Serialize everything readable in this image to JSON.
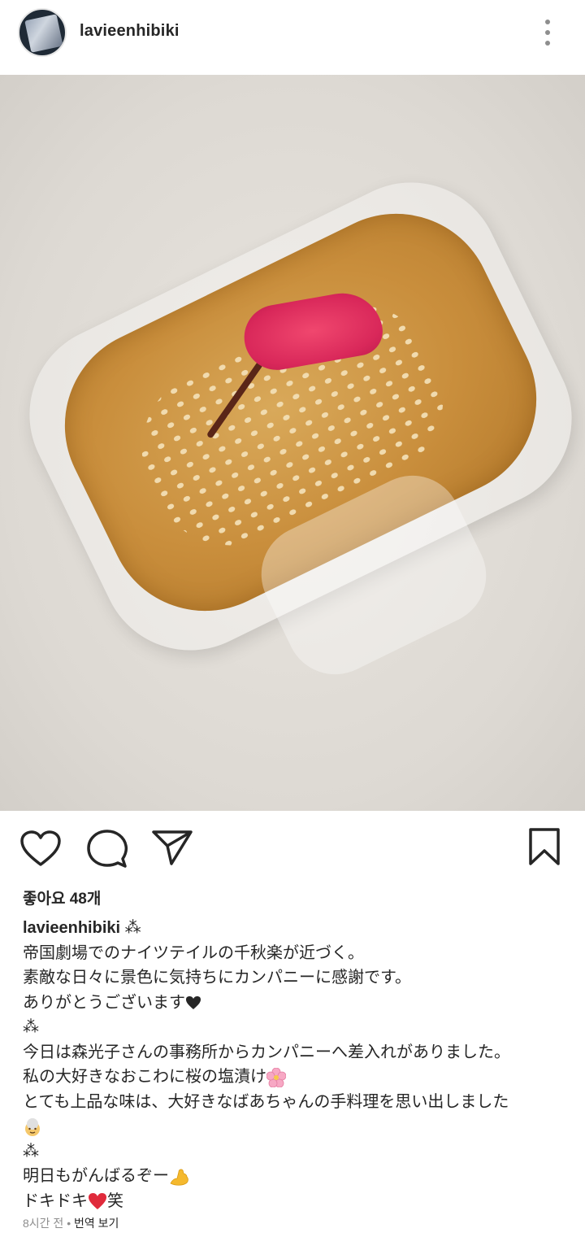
{
  "header": {
    "username": "lavieenhibiki"
  },
  "post": {
    "likes": "좋아요 48개",
    "caption": {
      "owner": "lavieenhibiki",
      "lines": [
        "⁂",
        "帝国劇場でのナイツテイルの千秋楽が近づく。",
        "素敵な日々に景色に気持ちにカンパニーに感謝です。",
        "ありがとうございます",
        "⁂",
        "今日は森光子さんの事務所からカンパニーへ差入れがありました。",
        "私の大好きなおこわに桜の塩漬け",
        "とても上品な味は、大好きなばあちゃんの手料理を思い出しました",
        "",
        "⁂",
        "明日もがんばるぞー",
        "ドキドキ",
        "笑"
      ]
    },
    "time_ago": "8시간 전",
    "separator": " • ",
    "translate_label": "번역 보기"
  },
  "icons": {
    "more": "more-vertical-icon",
    "like": "heart-outline-icon",
    "comment": "comment-bubble-icon",
    "share": "paper-plane-icon",
    "save": "bookmark-icon"
  }
}
